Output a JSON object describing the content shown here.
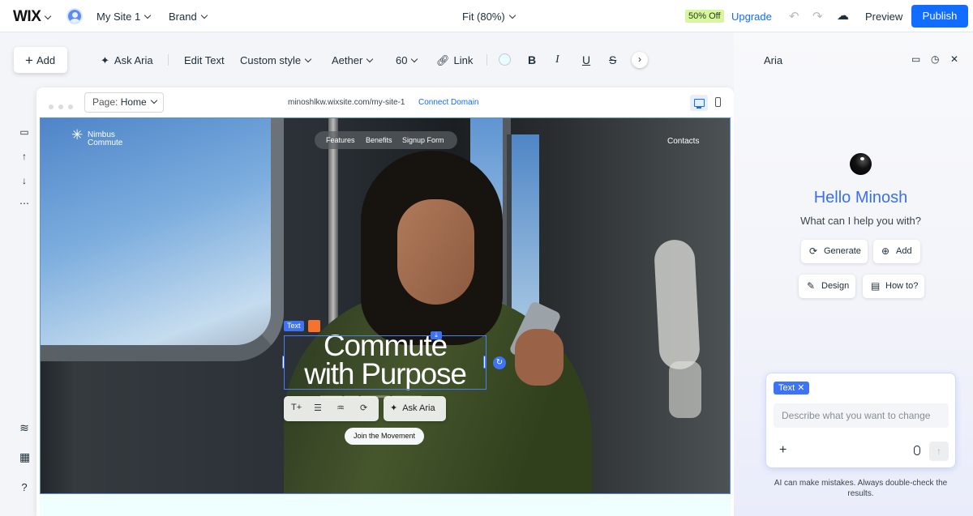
{
  "topbar": {
    "logo": "WIX",
    "site_name": "My Site 1",
    "brand": "Brand",
    "zoom": "Fit (80%)",
    "sale_badge": "50% Off",
    "upgrade": "Upgrade",
    "preview": "Preview",
    "publish": "Publish"
  },
  "toolbar": {
    "add": "Add",
    "ask_aria": "Ask Aria",
    "edit_text": "Edit Text",
    "style": "Custom style",
    "font": "Aether",
    "font_size": "60",
    "link": "Link",
    "bold": "B",
    "italic": "I",
    "underline": "U",
    "strike": "S"
  },
  "canvas": {
    "page_label": "Page:",
    "page_name": "Home",
    "url": "minoshlkw.wixsite.com/my-site-1",
    "connect_domain": "Connect Domain"
  },
  "hero": {
    "logo_line1": "Nimbus",
    "logo_line2": "Commute",
    "nav": [
      "Features",
      "Benefits",
      "Signup Form"
    ],
    "contacts": "Contacts",
    "heading_line1": "Commute",
    "heading_line2": "with Purpose",
    "text_tag": "Text",
    "ask_aria": "Ask Aria",
    "join_button": "Join the Movement"
  },
  "aria": {
    "title": "Aria",
    "greeting": "Hello Minosh",
    "prompt": "What can I help you with?",
    "chips": [
      "Generate",
      "Add",
      "Design",
      "How to?"
    ],
    "input_tag": "Text",
    "input_placeholder": "Describe what you want to change",
    "disclaimer": "AI can make mistakes. Always double-check the results."
  },
  "colors": {
    "accent": "#116dff",
    "greeting": "#3b6ff2",
    "selection": "#3c73f7",
    "sale_badge": "#d8f6a0"
  }
}
